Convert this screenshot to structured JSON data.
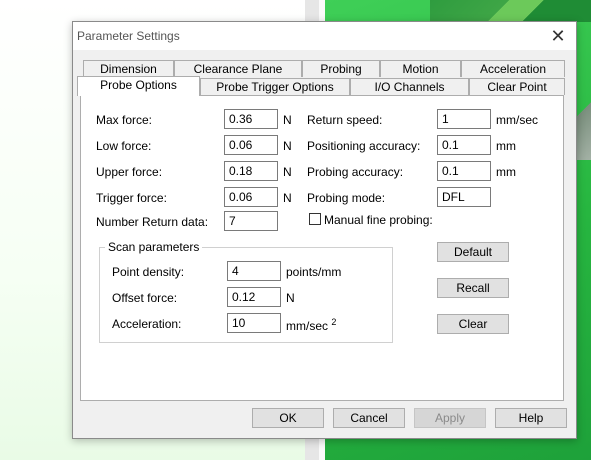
{
  "window": {
    "title": "Parameter Settings",
    "close": "✕"
  },
  "tabs_row1": [
    "Dimension",
    "Clearance Plane",
    "Probing",
    "Motion",
    "Acceleration"
  ],
  "tabs_row2": [
    "Probe Options",
    "Probe Trigger Options",
    "I/O Channels",
    "Clear Point"
  ],
  "active_tab": "Probe Options",
  "left_fields": [
    {
      "label": "Max force:",
      "value": "0.36",
      "unit": "N"
    },
    {
      "label": "Low force:",
      "value": "0.06",
      "unit": "N"
    },
    {
      "label": "Upper force:",
      "value": "0.18",
      "unit": "N"
    },
    {
      "label": "Trigger force:",
      "value": "0.06",
      "unit": "N"
    },
    {
      "label": "Number Return data:",
      "value": "7",
      "unit": ""
    }
  ],
  "right_fields": [
    {
      "label": "Return speed:",
      "value": "1",
      "unit": "mm/sec"
    },
    {
      "label": "Positioning accuracy:",
      "value": "0.1",
      "unit": "mm"
    },
    {
      "label": "Probing accuracy:",
      "value": "0.1",
      "unit": "mm"
    },
    {
      "label": "Probing mode:",
      "value": "DFL",
      "unit": ""
    }
  ],
  "manual_fine_probing": {
    "label": "Manual fine probing:",
    "checked": false
  },
  "scan": {
    "caption": "Scan parameters",
    "fields": [
      {
        "label": "Point density:",
        "value": "4",
        "unit": "points/mm"
      },
      {
        "label": "Offset force:",
        "value": "0.12",
        "unit": "N"
      },
      {
        "label": "Acceleration:",
        "value": "10",
        "unit": "mm/sec",
        "sup": "2"
      }
    ]
  },
  "side_buttons": [
    "Default",
    "Recall",
    "Clear"
  ],
  "footer_buttons": {
    "ok": "OK",
    "cancel": "Cancel",
    "apply": "Apply",
    "help": "Help"
  }
}
